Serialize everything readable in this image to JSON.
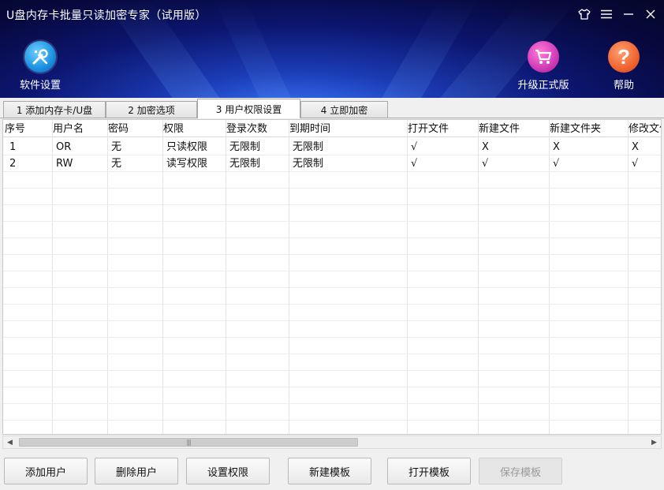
{
  "window": {
    "title": "U盘内存卡批量只读加密专家（试用版）",
    "controls": [
      "skin-icon",
      "menu-icon",
      "minimize-icon",
      "close-icon"
    ]
  },
  "toolbar": {
    "settings_label": "软件设置",
    "upgrade_label": "升级正式版",
    "help_label": "帮助",
    "help_glyph": "?"
  },
  "tabs": [
    {
      "label": "1 添加内存卡/U盘",
      "active": false
    },
    {
      "label": "2 加密选项",
      "active": false
    },
    {
      "label": "3 用户权限设置",
      "active": true
    },
    {
      "label": "4 立即加密",
      "active": false
    }
  ],
  "table": {
    "columns": [
      "序号",
      "用户名",
      "密码",
      "权限",
      "登录次数",
      "到期时间",
      "打开文件",
      "新建文件",
      "新建文件夹",
      "修改文件"
    ],
    "rows": [
      [
        "1",
        "OR",
        "无",
        "只读权限",
        "无限制",
        "无限制",
        "√",
        "X",
        "X",
        "X"
      ],
      [
        "2",
        "RW",
        "无",
        "读写权限",
        "无限制",
        "无限制",
        "√",
        "√",
        "√",
        "√"
      ]
    ]
  },
  "scrollbar": {
    "left_arrow": "◀",
    "right_arrow": "▶",
    "grip": "|||"
  },
  "buttons": {
    "add_user": "添加用户",
    "delete_user": "删除用户",
    "set_permission": "设置权限",
    "new_template": "新建模板",
    "open_template": "打开模板",
    "save_template": "保存模板"
  },
  "colors": {
    "settings_accent": "#1a8fe0",
    "upgrade_accent": "#d03bb8",
    "help_accent": "#f06430"
  }
}
